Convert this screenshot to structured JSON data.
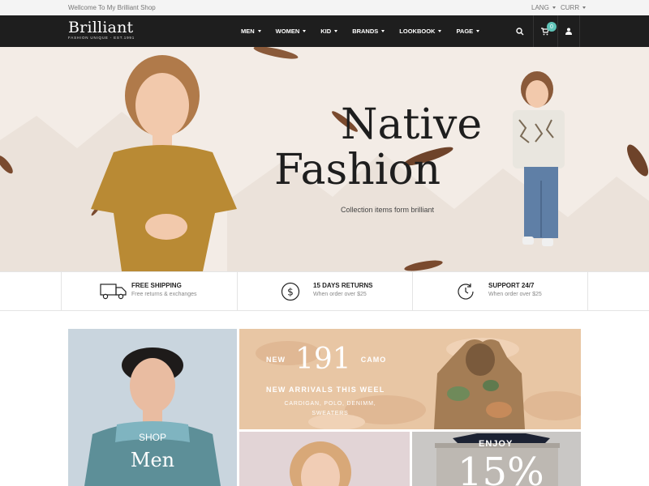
{
  "topbar": {
    "welcome": "Wellcome To My Brilliant Shop",
    "lang": "LANG",
    "curr": "CURR"
  },
  "header": {
    "logo_name": "Brilliant",
    "logo_tag": "FASHION UNIQUE - EST.1991",
    "nav": [
      "MEN",
      "WOMEN",
      "KID",
      "BRANDS",
      "LOOKBOOK",
      "PAGE"
    ],
    "cart_count": "0",
    "icons": [
      "search-icon",
      "cart-icon",
      "user-icon"
    ]
  },
  "hero": {
    "title_line1": "Native",
    "title_line2": "Fashion",
    "subtitle": "Collection items form brilliant"
  },
  "features": [
    {
      "title": "FREE SHIPPING",
      "desc": "Free returns & exchanges",
      "icon": "truck-icon"
    },
    {
      "title": "15 DAYS RETURNS",
      "desc": "When order over $25",
      "icon": "dollar-icon"
    },
    {
      "title": "SUPPORT 24/7",
      "desc": "When order over $25",
      "icon": "clock-icon"
    }
  ],
  "banners": {
    "men": {
      "shop": "SHOP",
      "title": "Men"
    },
    "camo": {
      "new": "NEW",
      "number": "191",
      "camo": "CAMO",
      "arrivals": "NEW ARRIVALS THIS WEEL",
      "categories": "CARDIGAN, POLO, DENIMM, SWEATERS"
    },
    "enjoy": {
      "label": "ENJOY",
      "value": "15%"
    }
  },
  "colors": {
    "header_bg": "#1e1e1e",
    "accent": "#5fc4b8",
    "hero_bg": "#f3ece6",
    "camo_bg": "#e8c6a4"
  }
}
